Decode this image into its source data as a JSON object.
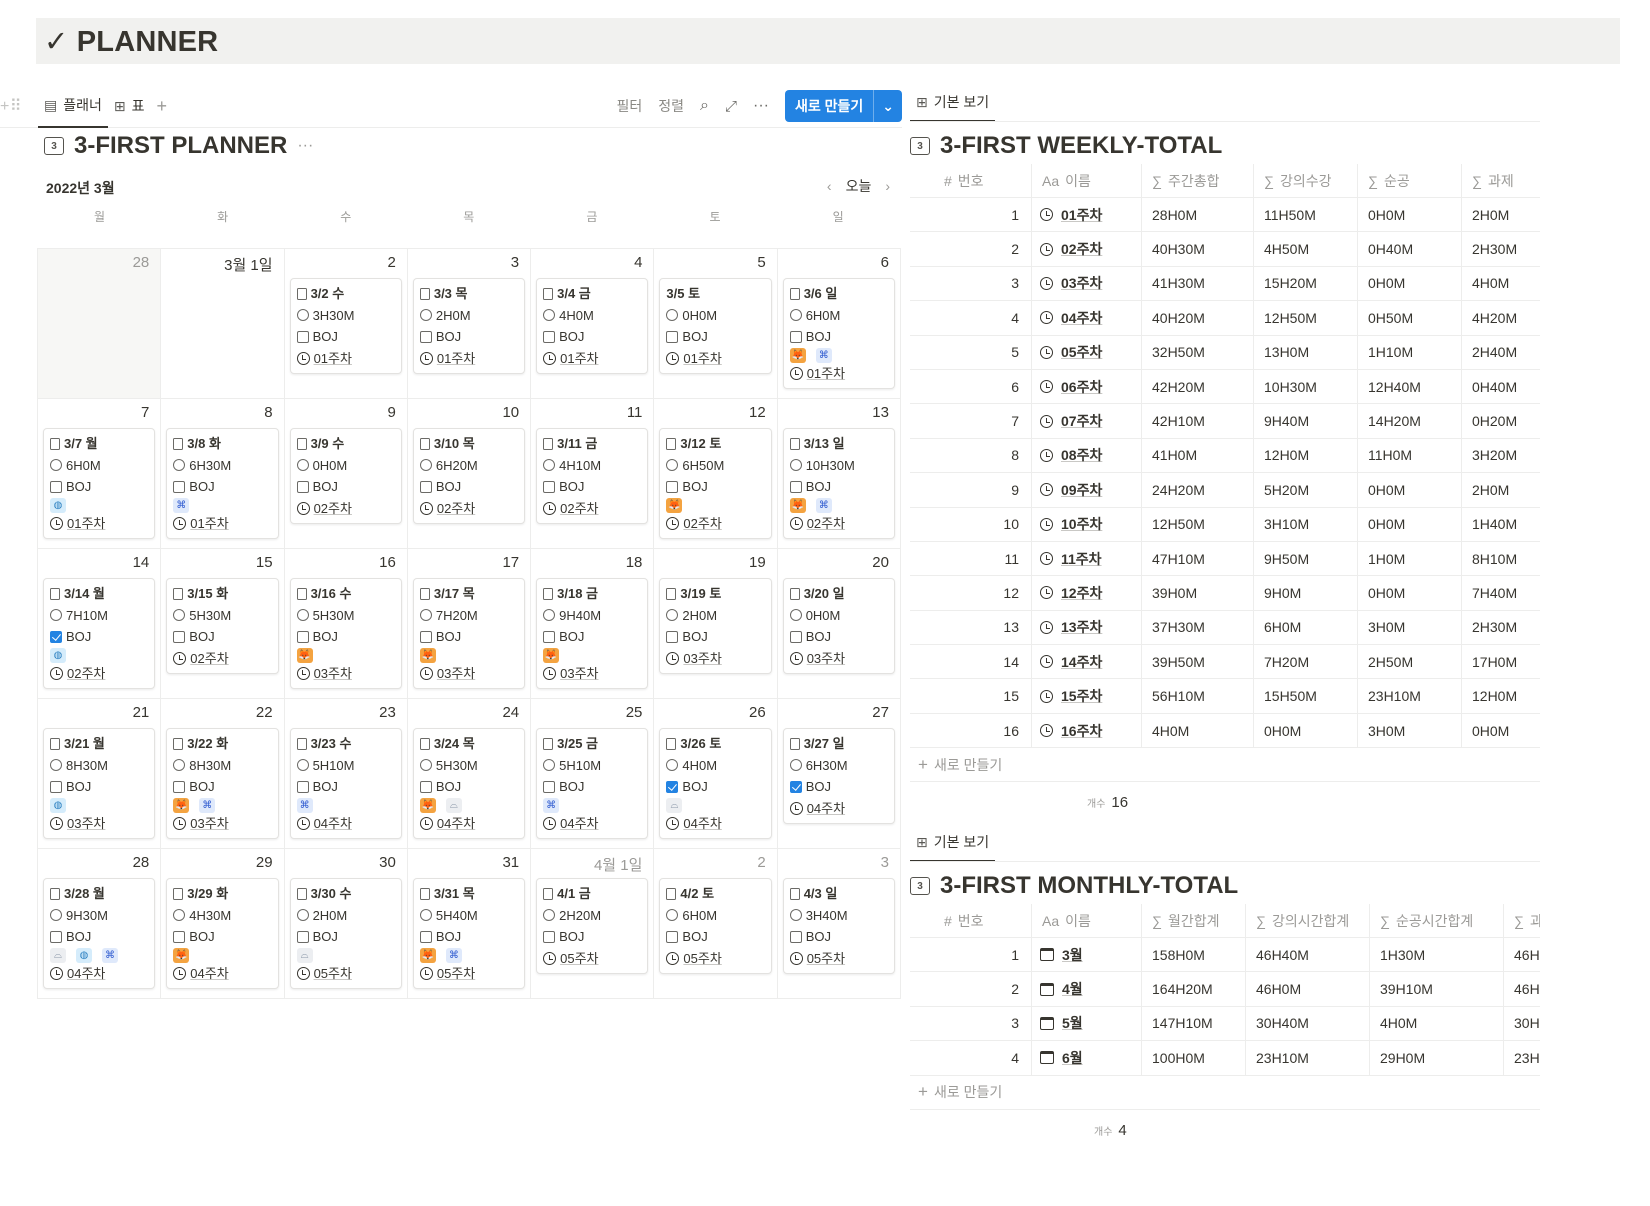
{
  "page": {
    "title": "✓ PLANNER"
  },
  "planner": {
    "tabs": [
      {
        "label": "플래너"
      },
      {
        "label": "표"
      }
    ],
    "tools": {
      "filter": "필터",
      "sort": "정렬",
      "new": "새로 만들기"
    },
    "title": "3-FIRST PLANNER",
    "month": "2022년 3월",
    "today": "오늘",
    "weekdays": [
      "월",
      "화",
      "수",
      "목",
      "금",
      "토",
      "일"
    ],
    "weeks": [
      [
        {
          "day": "28",
          "pad": true
        },
        {
          "day": "3월 1일"
        },
        {
          "day": "2",
          "card": {
            "date": "3/2 수",
            "time": "3H30M",
            "done": false,
            "emoji": [],
            "week": "01주차"
          }
        },
        {
          "day": "3",
          "card": {
            "date": "3/3 목",
            "time": "2H0M",
            "done": false,
            "emoji": [],
            "week": "01주차"
          }
        },
        {
          "day": "4",
          "card": {
            "date": "3/4 금",
            "time": "4H0M",
            "done": false,
            "emoji": [],
            "week": "01주차"
          }
        },
        {
          "day": "5",
          "card": {
            "date": "3/5 토",
            "time": "0H0M",
            "done": false,
            "emoji": [],
            "week": "01주차",
            "noIcon": true
          }
        },
        {
          "day": "6",
          "card": {
            "date": "3/6 일",
            "time": "6H0M",
            "done": false,
            "emoji": [
              "fox",
              "code"
            ],
            "week": "01주차"
          }
        }
      ],
      [
        {
          "day": "7",
          "card": {
            "date": "3/7 월",
            "time": "6H0M",
            "done": false,
            "emoji": [
              "globe"
            ],
            "week": "01주차"
          }
        },
        {
          "day": "8",
          "card": {
            "date": "3/8 화",
            "time": "6H30M",
            "done": false,
            "emoji": [
              "code"
            ],
            "week": "01주차"
          }
        },
        {
          "day": "9",
          "card": {
            "date": "3/9 수",
            "time": "0H0M",
            "done": false,
            "emoji": [],
            "week": "02주차"
          }
        },
        {
          "day": "10",
          "card": {
            "date": "3/10 목",
            "time": "6H20M",
            "done": false,
            "emoji": [],
            "week": "02주차"
          }
        },
        {
          "day": "11",
          "card": {
            "date": "3/11 금",
            "time": "4H10M",
            "done": false,
            "emoji": [],
            "week": "02주차"
          }
        },
        {
          "day": "12",
          "card": {
            "date": "3/12 토",
            "time": "6H50M",
            "done": false,
            "emoji": [
              "fox"
            ],
            "week": "02주차"
          }
        },
        {
          "day": "13",
          "card": {
            "date": "3/13 일",
            "time": "10H30M",
            "done": false,
            "emoji": [
              "fox",
              "code"
            ],
            "week": "02주차"
          }
        }
      ],
      [
        {
          "day": "14",
          "card": {
            "date": "3/14 월",
            "time": "7H10M",
            "done": true,
            "emoji": [
              "globe"
            ],
            "week": "02주차"
          }
        },
        {
          "day": "15",
          "card": {
            "date": "3/15 화",
            "time": "5H30M",
            "done": false,
            "emoji": [],
            "week": "02주차"
          }
        },
        {
          "day": "16",
          "card": {
            "date": "3/16 수",
            "time": "5H30M",
            "done": false,
            "emoji": [
              "fox"
            ],
            "week": "03주차"
          }
        },
        {
          "day": "17",
          "card": {
            "date": "3/17 목",
            "time": "7H20M",
            "done": false,
            "emoji": [
              "fox"
            ],
            "week": "03주차"
          }
        },
        {
          "day": "18",
          "card": {
            "date": "3/18 금",
            "time": "9H40M",
            "done": false,
            "emoji": [
              "fox"
            ],
            "week": "03주차"
          }
        },
        {
          "day": "19",
          "card": {
            "date": "3/19 토",
            "time": "2H0M",
            "done": false,
            "emoji": [],
            "week": "03주차"
          }
        },
        {
          "day": "20",
          "card": {
            "date": "3/20 일",
            "time": "0H0M",
            "done": false,
            "emoji": [],
            "week": "03주차"
          }
        }
      ],
      [
        {
          "day": "21",
          "card": {
            "date": "3/21 월",
            "time": "8H30M",
            "done": false,
            "emoji": [
              "globe"
            ],
            "week": "03주차"
          }
        },
        {
          "day": "22",
          "card": {
            "date": "3/22 화",
            "time": "8H30M",
            "done": false,
            "emoji": [
              "fox",
              "code"
            ],
            "week": "03주차"
          }
        },
        {
          "day": "23",
          "card": {
            "date": "3/23 수",
            "time": "5H10M",
            "done": false,
            "emoji": [
              "code"
            ],
            "week": "04주차"
          }
        },
        {
          "day": "24",
          "card": {
            "date": "3/24 목",
            "time": "5H30M",
            "done": false,
            "emoji": [
              "fox",
              "bath"
            ],
            "week": "04주차"
          }
        },
        {
          "day": "25",
          "card": {
            "date": "3/25 금",
            "time": "5H10M",
            "done": false,
            "emoji": [
              "code"
            ],
            "week": "04주차"
          }
        },
        {
          "day": "26",
          "card": {
            "date": "3/26 토",
            "time": "4H0M",
            "done": true,
            "emoji": [
              "bath"
            ],
            "week": "04주차"
          }
        },
        {
          "day": "27",
          "card": {
            "date": "3/27 일",
            "time": "6H30M",
            "done": true,
            "emoji": [],
            "week": "04주차"
          }
        }
      ],
      [
        {
          "day": "28",
          "card": {
            "date": "3/28 월",
            "time": "9H30M",
            "done": false,
            "emoji": [
              "bath",
              "globe",
              "code"
            ],
            "week": "04주차"
          }
        },
        {
          "day": "29",
          "card": {
            "date": "3/29 화",
            "time": "4H30M",
            "done": false,
            "emoji": [
              "fox"
            ],
            "week": "04주차"
          }
        },
        {
          "day": "30",
          "card": {
            "date": "3/30 수",
            "time": "2H0M",
            "done": false,
            "emoji": [
              "bath"
            ],
            "week": "05주차"
          }
        },
        {
          "day": "31",
          "card": {
            "date": "3/31 목",
            "time": "5H40M",
            "done": false,
            "emoji": [
              "fox",
              "code"
            ],
            "week": "05주차"
          }
        },
        {
          "day": "4월 1일",
          "dim": true,
          "card": {
            "date": "4/1 금",
            "time": "2H20M",
            "done": false,
            "emoji": [],
            "week": "05주차"
          }
        },
        {
          "day": "2",
          "dim": true,
          "card": {
            "date": "4/2 토",
            "time": "6H0M",
            "done": false,
            "emoji": [],
            "week": "05주차"
          }
        },
        {
          "day": "3",
          "dim": true,
          "card": {
            "date": "4/3 일",
            "time": "3H40M",
            "done": false,
            "emoji": [],
            "week": "05주차"
          }
        }
      ]
    ]
  },
  "weekly": {
    "tab": "기본 보기",
    "title": "3-FIRST WEEKLY-TOTAL",
    "headers": [
      "번호",
      "이름",
      "주간총합",
      "강의수강",
      "순공",
      "과제"
    ],
    "rows": [
      [
        "1",
        "01주차",
        "28H0M",
        "11H50M",
        "0H0M",
        "2H0M"
      ],
      [
        "2",
        "02주차",
        "40H30M",
        "4H50M",
        "0H40M",
        "2H30M"
      ],
      [
        "3",
        "03주차",
        "41H30M",
        "15H20M",
        "0H0M",
        "4H0M"
      ],
      [
        "4",
        "04주차",
        "40H20M",
        "12H50M",
        "0H50M",
        "4H20M"
      ],
      [
        "5",
        "05주차",
        "32H50M",
        "13H0M",
        "1H10M",
        "2H40M"
      ],
      [
        "6",
        "06주차",
        "42H20M",
        "10H30M",
        "12H40M",
        "0H40M"
      ],
      [
        "7",
        "07주차",
        "42H10M",
        "9H40M",
        "14H20M",
        "0H20M"
      ],
      [
        "8",
        "08주차",
        "41H0M",
        "12H0M",
        "11H0M",
        "3H20M"
      ],
      [
        "9",
        "09주차",
        "24H20M",
        "5H20M",
        "0H0M",
        "2H0M"
      ],
      [
        "10",
        "10주차",
        "12H50M",
        "3H10M",
        "0H0M",
        "1H40M"
      ],
      [
        "11",
        "11주차",
        "47H10M",
        "9H50M",
        "1H0M",
        "8H10M"
      ],
      [
        "12",
        "12주차",
        "39H0M",
        "9H0M",
        "0H0M",
        "7H40M"
      ],
      [
        "13",
        "13주차",
        "37H30M",
        "6H0M",
        "3H0M",
        "2H30M"
      ],
      [
        "14",
        "14주차",
        "39H50M",
        "7H20M",
        "2H50M",
        "17H0M"
      ],
      [
        "15",
        "15주차",
        "56H10M",
        "15H50M",
        "23H10M",
        "12H0M"
      ],
      [
        "16",
        "16주차",
        "4H0M",
        "0H0M",
        "3H0M",
        "0H0M"
      ]
    ],
    "new": "새로 만들기",
    "count_label": "개수",
    "count": "16"
  },
  "monthly": {
    "tab": "기본 보기",
    "title": "3-FIRST MONTHLY-TOTAL",
    "headers": [
      "번호",
      "이름",
      "월간합계",
      "강의시간합계",
      "순공시간합계",
      "과"
    ],
    "rows": [
      [
        "1",
        "3월",
        "158H0M",
        "46H40M",
        "1H30M",
        "46H"
      ],
      [
        "2",
        "4월",
        "164H20M",
        "46H0M",
        "39H10M",
        "46H"
      ],
      [
        "3",
        "5월",
        "147H10M",
        "30H40M",
        "4H0M",
        "30H"
      ],
      [
        "4",
        "6월",
        "100H0M",
        "23H10M",
        "29H0M",
        "23H"
      ]
    ],
    "new": "새로 만들기",
    "count_label": "개수",
    "count": "4"
  },
  "colors": {
    "accent": "#2383e2",
    "text": "#37352f",
    "muted": "#9b9a97",
    "border": "#ededec"
  }
}
